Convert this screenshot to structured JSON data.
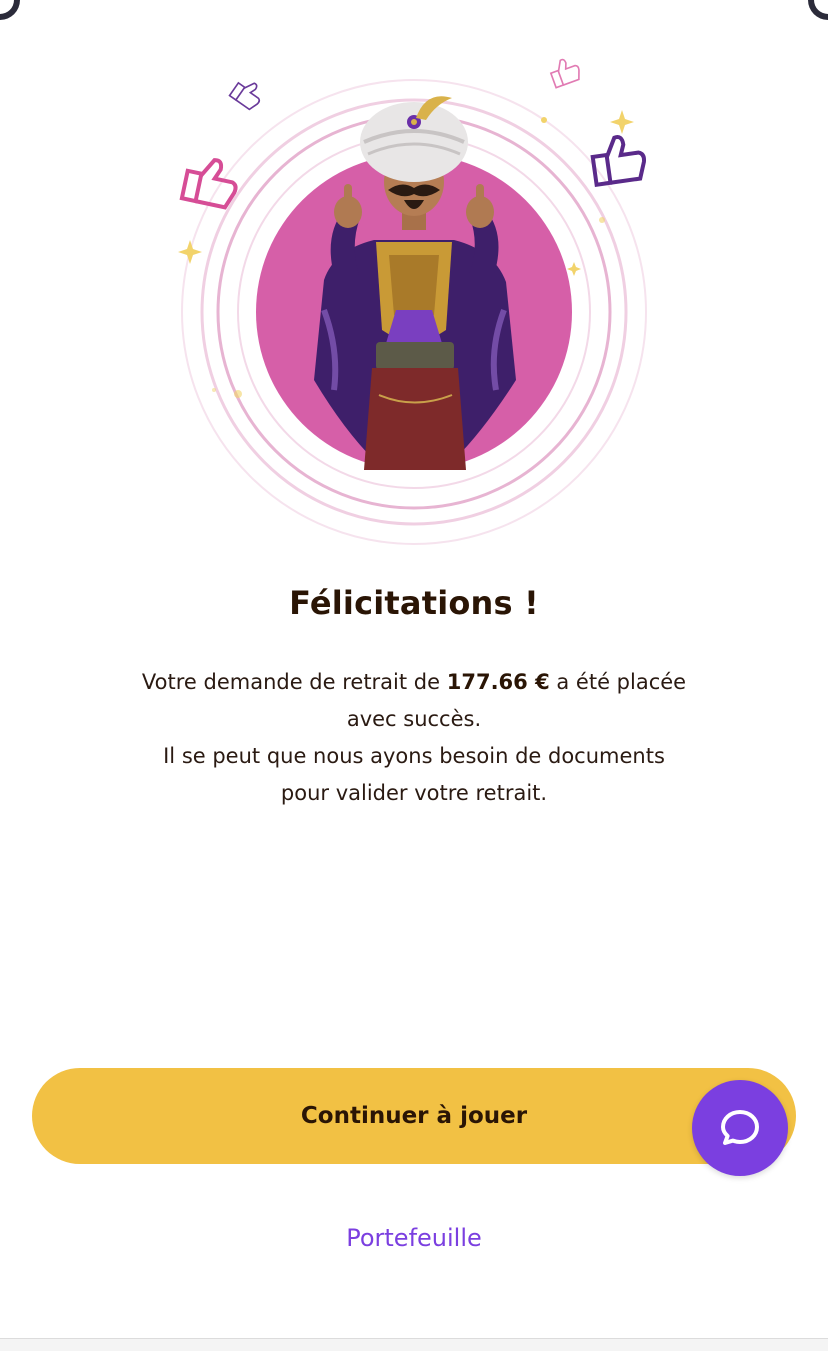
{
  "confirmation": {
    "title": "Félicitations !",
    "message_part1": "Votre demande de retrait de ",
    "amount": "177.66 €",
    "message_part2": " a été placée avec succès.",
    "message_part3": "Il se peut que nous ayons besoin de documents pour valider votre retrait."
  },
  "actions": {
    "continue_label": "Continuer à jouer",
    "wallet_link": "Portefeuille"
  },
  "chat": {
    "icon": "chat-bubble-icon"
  },
  "hero": {
    "icons": [
      "thumbs-up-icon",
      "sparkle-icon",
      "genie-character"
    ]
  },
  "colors": {
    "accent_yellow": "#f2c144",
    "accent_purple": "#7b3fe0",
    "hero_pink": "#d65fa8",
    "title_text": "#2a1505"
  }
}
